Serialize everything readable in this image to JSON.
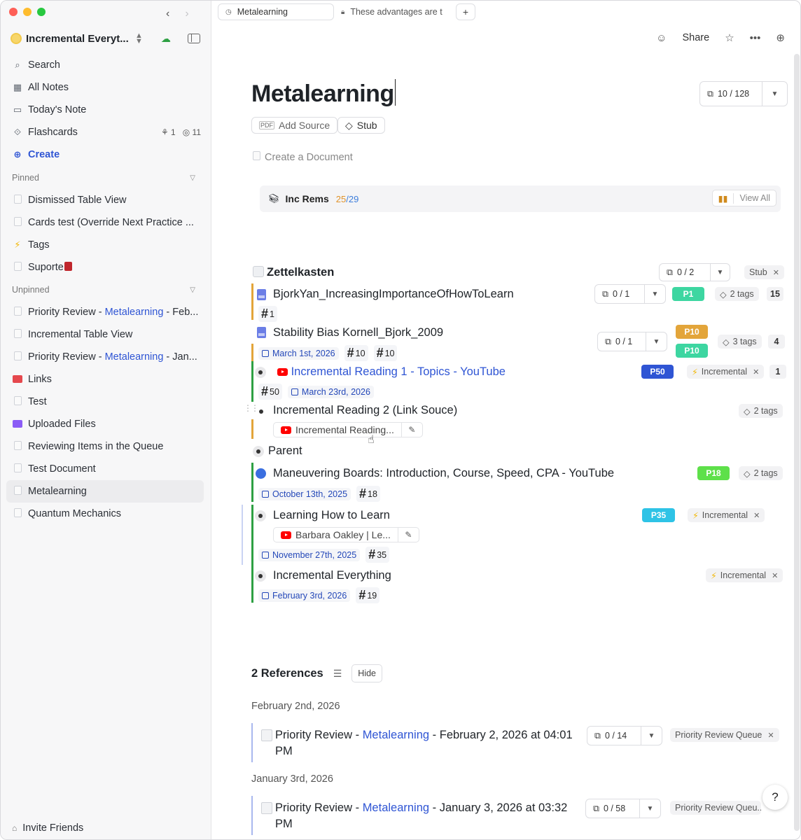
{
  "sidebar": {
    "workspace_name": "Incremental Everyt...",
    "nav": {
      "search": "Search",
      "all_notes": "All Notes",
      "todays_note": "Today's Note",
      "flashcards": "Flashcards",
      "flashcards_due_a": "1",
      "flashcards_due_b": "11",
      "create": "Create"
    },
    "pinned_label": "Pinned",
    "pinned": [
      "Dismissed Table View",
      "Cards test (Override Next Practice ...",
      "Tags",
      "Suporte"
    ],
    "unpinned_label": "Unpinned",
    "unpinned": {
      "item1_pre": "Priority Review - ",
      "item1_hl": "Metalearning",
      "item1_post": " - Feb...",
      "item2": "Incremental Table View",
      "item3_pre": "Priority Review - ",
      "item3_hl": "Metalearning",
      "item3_post": " - Jan...",
      "item4": "Links",
      "item5": "Test",
      "item6": "Uploaded Files",
      "item7": "Reviewing Items in the Queue",
      "item8": "Test Document",
      "item9": "Metalearning",
      "item10": "Quantum Mechanics"
    },
    "invite": "Invite Friends"
  },
  "tabs": {
    "active": "Metalearning",
    "inactive": "These advantages are t",
    "add": "+"
  },
  "toolbar": {
    "share": "Share"
  },
  "page": {
    "title": "Metalearning",
    "card_count": "10 / 128",
    "add_source": "Add Source",
    "stub": "Stub",
    "create_document": "Create a Document",
    "inc_rems_label": "Inc Rems",
    "inc_rems_a": "25",
    "inc_rems_sep": " / ",
    "inc_rems_b": "29",
    "view_all": "View All"
  },
  "rems": {
    "zettel": {
      "title": "Zettelkasten",
      "cards": "0 / 2",
      "tag": "Stub"
    },
    "r1": {
      "title": "BjorkYan_IncreasingImportanceOfHowToLearn",
      "cards": "0 / 1",
      "prio": "P1",
      "tags": "2 tags",
      "count": "15",
      "hash": "1"
    },
    "r2": {
      "title": "Stability Bias Kornell_Bjork_2009",
      "cards": "0 / 1",
      "prio_a": "P10",
      "prio_b": "P10",
      "tags": "3 tags",
      "count": "4",
      "date": "March 1st, 2026",
      "hash_a": "10",
      "hash_b": "10"
    },
    "r3": {
      "title": "Incremental Reading 1 - Topics - YouTube",
      "prio": "P50",
      "tag": "Incremental",
      "count": "1",
      "hash": "50",
      "date": "March 23rd, 2026"
    },
    "r4": {
      "title": "Incremental Reading 2 (Link Souce)",
      "tags": "2 tags",
      "link": "Incremental Reading..."
    },
    "r5": {
      "title": "Parent"
    },
    "r6": {
      "title": "Maneuvering Boards: Introduction, Course, Speed, CPA - YouTube",
      "prio": "P18",
      "tags": "2 tags",
      "date": "October 13th, 2025",
      "hash": "18"
    },
    "r7": {
      "title": "Learning How to Learn",
      "prio": "P35",
      "tag": "Incremental",
      "link": "Barbara Oakley | Le...",
      "date": "November 27th, 2025",
      "hash": "35"
    },
    "r8": {
      "title": "Incremental Everything",
      "tag": "Incremental",
      "date": "February 3rd, 2026",
      "hash": "19"
    }
  },
  "references": {
    "title": "2 References",
    "hide": "Hide",
    "group1_date": "February 2nd, 2026",
    "ref1_pre": "Priority Review - ",
    "ref1_hl": "Metalearning",
    "ref1_post": " - February 2, 2026 at 04:01 PM",
    "ref1_cards": "0 / 14",
    "ref1_tag": "Priority Review Queue",
    "group2_date": "January 3rd, 2026",
    "ref2_pre": "Priority Review - ",
    "ref2_hl": "Metalearning",
    "ref2_post": " - January 3, 2026 at 03:32 PM",
    "ref2_cards": "0 / 58",
    "ref2_tag": "Priority Review Queu..."
  },
  "help": "?",
  "colors": {
    "accent": "#2f55d4",
    "green": "#2ea043",
    "orange": "#e3a53a"
  }
}
